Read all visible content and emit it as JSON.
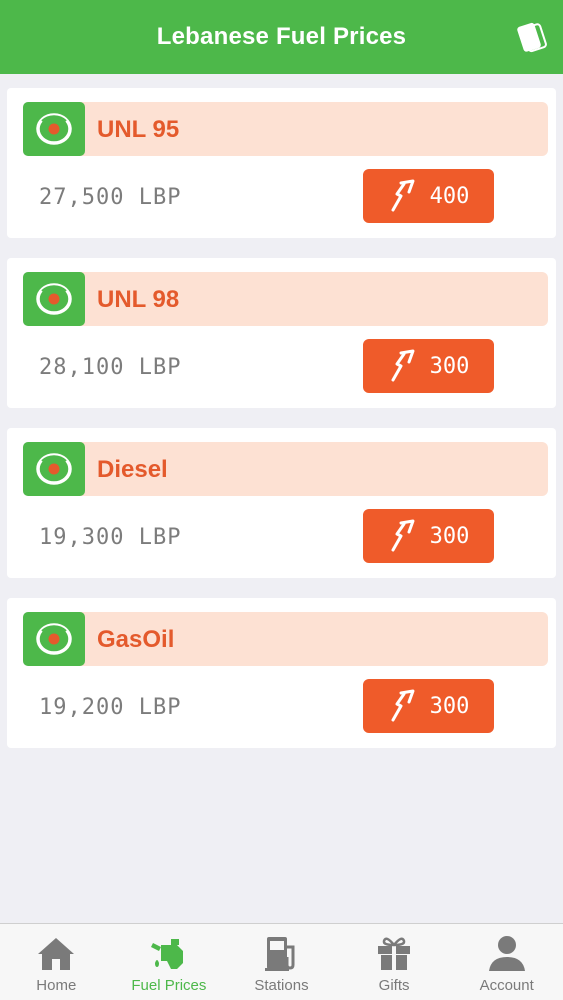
{
  "header": {
    "title": "Lebanese Fuel Prices",
    "card_icon": "card-icon"
  },
  "fuels": [
    {
      "name": "UNL 95",
      "price": "27,500 LBP",
      "change": "400",
      "change_icon": "trend-up-icon"
    },
    {
      "name": "UNL 98",
      "price": "28,100 LBP",
      "change": "300",
      "change_icon": "trend-up-icon"
    },
    {
      "name": "Diesel",
      "price": "19,300 LBP",
      "change": "300",
      "change_icon": "trend-up-icon"
    },
    {
      "name": "GasOil",
      "price": "19,200 LBP",
      "change": "300",
      "change_icon": "trend-up-icon"
    }
  ],
  "tabs": [
    {
      "label": "Home",
      "icon": "home-icon",
      "active": false
    },
    {
      "label": "Fuel Prices",
      "icon": "fuel-nozzle-icon",
      "active": true
    },
    {
      "label": "Stations",
      "icon": "gas-station-icon",
      "active": false
    },
    {
      "label": "Gifts",
      "icon": "gift-icon",
      "active": false
    },
    {
      "label": "Account",
      "icon": "account-icon",
      "active": false
    }
  ],
  "colors": {
    "brand_green": "#4db84a",
    "accent_orange": "#ef5b2a",
    "band_peach": "#fde1d3",
    "price_grey": "#7c7c7c"
  }
}
